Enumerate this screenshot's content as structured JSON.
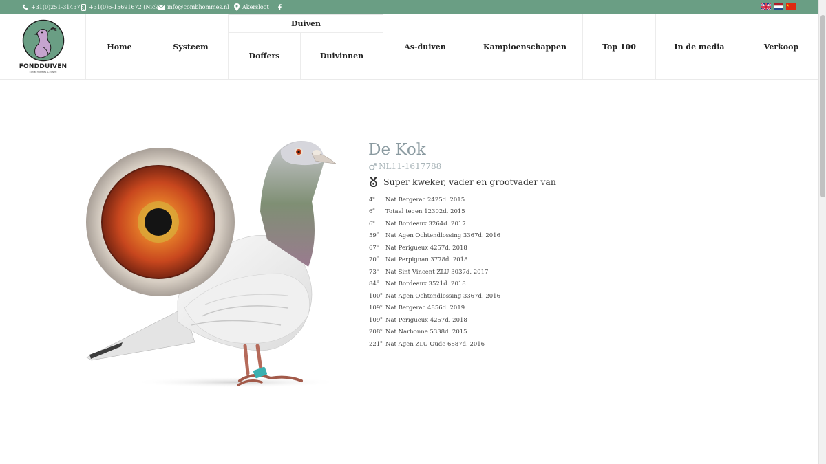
{
  "topbar": {
    "phone": "+31(0)251-314376",
    "mobile": "+31(0)6-15691672 (Nick)",
    "email": "info@combhommes.nl",
    "location": "Akersloot",
    "social_icon": "facebook-icon",
    "flags": [
      "english-flag",
      "dutch-flag",
      "chinese-flag"
    ]
  },
  "logo": {
    "text": "FONDDUIVEN",
    "subtext": "COMB. HOMMES & ZONEN"
  },
  "nav": {
    "home": "Home",
    "systeem": "Systeem",
    "duiven": "Duiven",
    "doffers": "Doffers",
    "duivinnen": "Duivinnen",
    "as_duiven": "As-duiven",
    "kampioenschappen": "Kampioenschappen",
    "top100": "Top 100",
    "media": "In de media",
    "verkoop": "Verkoop"
  },
  "pigeon": {
    "name": "De Kok",
    "ring": "NL11-1617788",
    "headline": "Super kweker, vader en grootvader van"
  },
  "results": [
    {
      "place": "4",
      "text": "Nat Bergerac 2425d. 2015"
    },
    {
      "place": "6",
      "text": "Totaal tegen 12302d. 2015"
    },
    {
      "place": "6",
      "text": "Nat Bordeaux 3264d. 2017"
    },
    {
      "place": "59",
      "text": "Nat Agen Ochtendlossing 3367d. 2016"
    },
    {
      "place": "67",
      "text": "Nat Perigueux 4257d. 2018"
    },
    {
      "place": "70",
      "text": "Nat Perpignan 3778d. 2018"
    },
    {
      "place": "73",
      "text": "Nat Sint Vincent ZLU 3037d. 2017"
    },
    {
      "place": "84",
      "text": "Nat Bordeaux 3521d. 2018"
    },
    {
      "place": "100",
      "text": "Nat Agen Ochtendlossing 3367d. 2016"
    },
    {
      "place": "109",
      "text": "Nat Bergerac 4856d. 2019"
    },
    {
      "place": "109",
      "text": "Nat Perigueux 4257d. 2018"
    },
    {
      "place": "208",
      "text": "Nat Narbonne 5338d. 2015"
    },
    {
      "place": "221",
      "text": "Nat Agen ZLU Oude 6887d. 2016"
    }
  ],
  "result_suffix": "e",
  "colors": {
    "topbar": "#6a9e84",
    "title": "#8a9aa0",
    "logo_circle": "#6a9e84"
  }
}
